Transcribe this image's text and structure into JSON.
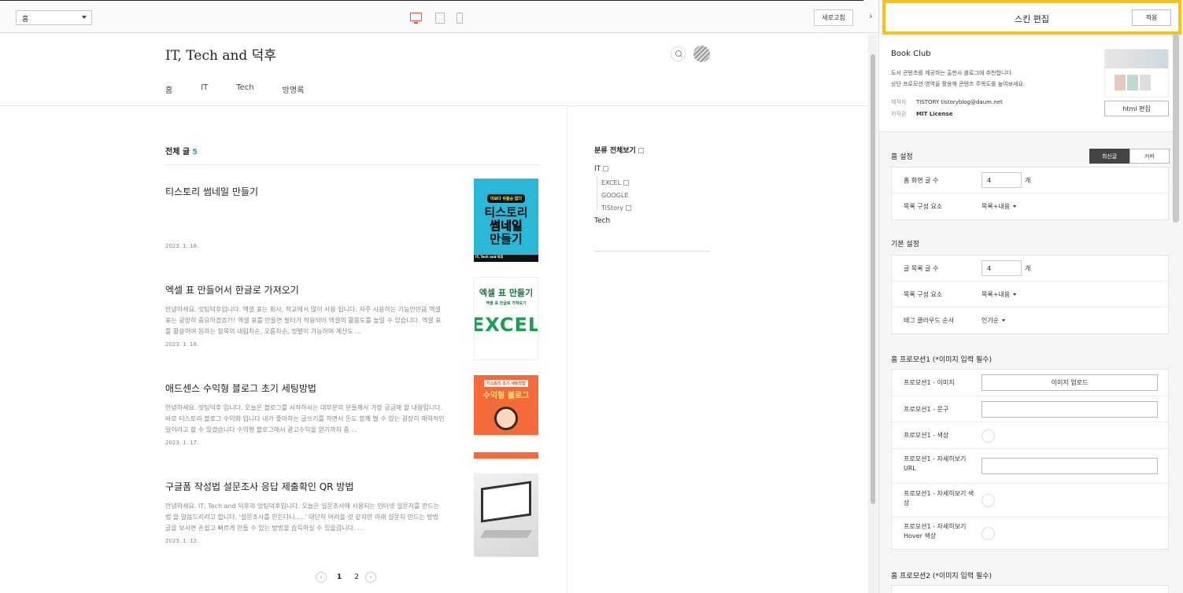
{
  "toolbar": {
    "page_select": "홈",
    "refresh_label": "새로고침",
    "collapse_glyph": "›"
  },
  "blog": {
    "title": "IT, Tech and 덕후",
    "nav": [
      "홈",
      "IT",
      "Tech",
      "방명록"
    ],
    "all_posts_label": "전체 글",
    "all_posts_count": "5",
    "posts": [
      {
        "title": "티스토리 썸네일 만들기",
        "excerpt": "",
        "date": "2023. 1. 18.",
        "thumb": {
          "badge": "이보다 쉬울순 없다",
          "l1": "티스토리",
          "l2": "썸네일",
          "l3": "만들기",
          "foot": "IT, Tech and 덕후"
        }
      },
      {
        "title": "엑셀 표 만들어서 한글로 가져오기",
        "excerpt": "안녕하세요. 엇팅덕후입니다. 엑셀 표는 회사, 학교에서 많이 사용 됩니다. 자주 사용하는 기능인만큼 엑셀 표는 굉장히 중요하겠죠?!! 엑셀 표를 만들면 필터가 적용되어 엑셀의 활용도를 높일 수 있습니다. 엑셀 표를 활용하여 원하는 항목의 내림차순, 오름차순, 정렬이 가능하며 계산도 ...",
        "date": "2023. 1. 18.",
        "thumb": {
          "l1": "엑셀 표 만들기",
          "l2": "엑셀 표 한글로 가져오기",
          "l3": "EXCEL"
        }
      },
      {
        "title": "애드센스 수익형 블로그 초기 세팅방법",
        "excerpt": "안녕하세요. 엇팅덕후 입니다. 오늘은 블로그를 시작하시는 대부분의 분들께서 가장 궁금해 할 내용입니다. 바로 티스토리 블로그 수익화 입니다 내가 좋아하는 글쓰기를 하면서 돈도 함께 벌 수 있는 굉장히 매력적인 일이라고 할 수 있겠습니다 수익형 블로그에서 광고수익을 얻기까지 중 ...",
        "date": "2023. 1. 17.",
        "thumb": {
          "l1": "티스토리 초기 세팅방법",
          "l2": "수익형 블로그"
        }
      },
      {
        "title": "구글폼 작성법 설문조사 응답 제출확인 QR 방법",
        "excerpt": "안녕하세요. IT, Tech and 덕후의 엇팅덕후입니다. 오늘은 설문조사에 사용되는 인터넷 설문지를 만드는법 을 말씀드리려고 합니다. '설문조사를 만든다니.....' 대단히 어려울 것 같지만 아래 설문지 만드는 방법 글을 보시면 손쉽고 빠르게 만들 수 있는 방법을 습득하실 수 있을겁니다. ...",
        "date": "2023. 1. 12.",
        "thumb": {}
      }
    ],
    "sidebar": {
      "title": "분류 전체보기",
      "cat_it": "IT",
      "subs": [
        "EXCEL",
        "GOOGLE",
        "TiStory"
      ],
      "cat_tech": "Tech"
    },
    "pagination": {
      "prev": "‹",
      "pages": [
        "1",
        "2"
      ],
      "next": "›"
    }
  },
  "panel": {
    "title": "스킨 편집",
    "apply_label": "적용",
    "skin": {
      "name": "Book Club",
      "desc1": "도서 콘텐츠를 제공하는 출판사 블로그에 추천합니다.",
      "desc2": "상단 프로모션 영역을 활용해 콘텐츠 주목도를 높여보세요.",
      "maker_key": "제작자",
      "maker_val": "TISTORY tistoryblog@daum.net",
      "license_key": "저작권",
      "license_val": "MIT License",
      "html_edit_label": "html 편집"
    },
    "home_settings": {
      "title": "홈 설정",
      "seg": [
        "최신글",
        "커버"
      ],
      "rows": {
        "count_label": "홈 화면 글 수",
        "count_value": "4",
        "unit": "개",
        "compose_label": "목록 구성 요소",
        "compose_value": "목록+내용"
      }
    },
    "basic_settings": {
      "title": "기본 설정",
      "count_label": "글 목록 글 수",
      "count_value": "4",
      "unit": "개",
      "compose_label": "목록 구성 요소",
      "compose_value": "목록+내용",
      "tag_label": "태그 클라우드 순서",
      "tag_value": "인기순"
    },
    "promo1": {
      "title": "홈 프로모션1 (*이미지 입력 필수)",
      "image_label": "프로모션1 - 이미지",
      "upload_label": "이미지 업로드",
      "text_label": "프로모션1 - 문구",
      "color_label": "프로모션1 - 색상",
      "url_label_1": "프로모션1 - 자세히보기",
      "url_label_2": "URL",
      "more_color_label_1": "프로모션1 - 자세히보기 색",
      "more_color_label_2": "상",
      "hover_label_1": "프로모션1 - 자세히보기",
      "hover_label_2": "Hover 색상"
    },
    "promo2": {
      "title": "홈 프로모션2 (*이미지 입력 필수)"
    }
  },
  "colors": {
    "accent_highlight": "#f7c31b",
    "count_accent": "#2aa6c6",
    "desktop_active": "#e2574c"
  }
}
